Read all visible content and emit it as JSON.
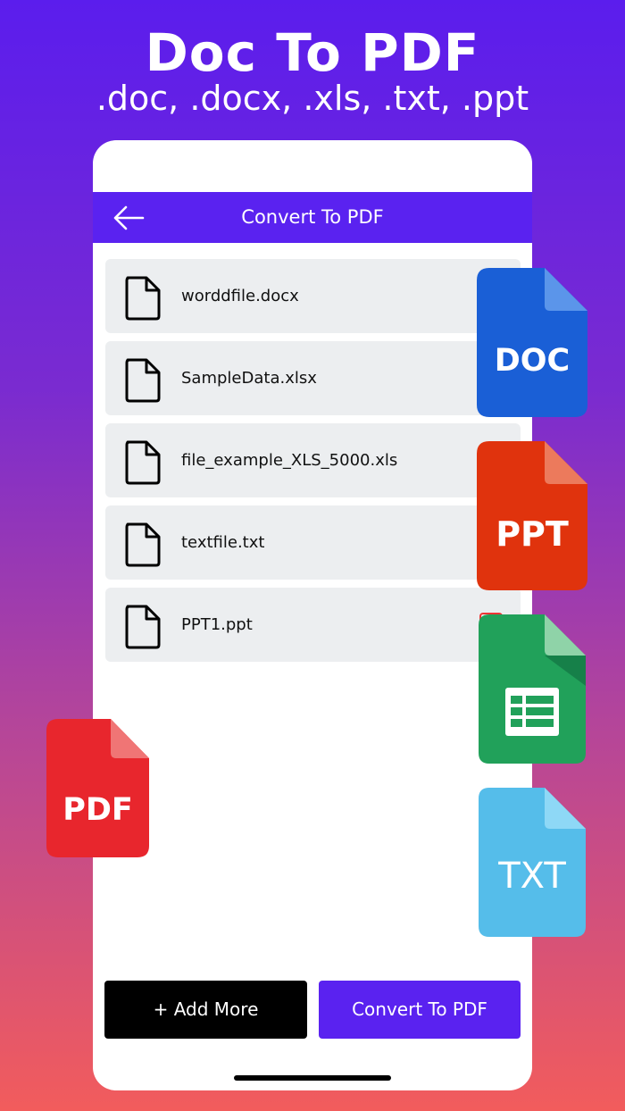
{
  "promo": {
    "title": "Doc To PDF",
    "subtitle": ".doc, .docx, .xls, .txt, .ppt"
  },
  "appbar": {
    "title": "Convert To PDF",
    "back_icon": "arrow-left-icon"
  },
  "files": [
    {
      "name": "worddfile.docx"
    },
    {
      "name": "SampleData.xlsx"
    },
    {
      "name": "file_example_XLS_5000.xls"
    },
    {
      "name": "textfile.txt"
    },
    {
      "name": "PPT1.ppt"
    }
  ],
  "actions": {
    "add_more_label": "+ Add More",
    "convert_label": "Convert To PDF"
  },
  "badges": {
    "doc": {
      "label": "DOC",
      "color": "#1a5fd6",
      "fold": "#5b95ea"
    },
    "ppt": {
      "label": "PPT",
      "color": "#e0330d",
      "fold": "#ec7a5c"
    },
    "xls": {
      "label": "",
      "color": "#21a15a",
      "fold": "#8fd3a8"
    },
    "txt": {
      "label": "TXT",
      "color": "#55bdea",
      "fold": "#8ed8f6"
    },
    "pdf": {
      "label": "PDF",
      "color": "#e8262d",
      "fold": "#f07575"
    }
  },
  "colors": {
    "accent": "#5a22f0",
    "row_bg": "#eceef0"
  }
}
